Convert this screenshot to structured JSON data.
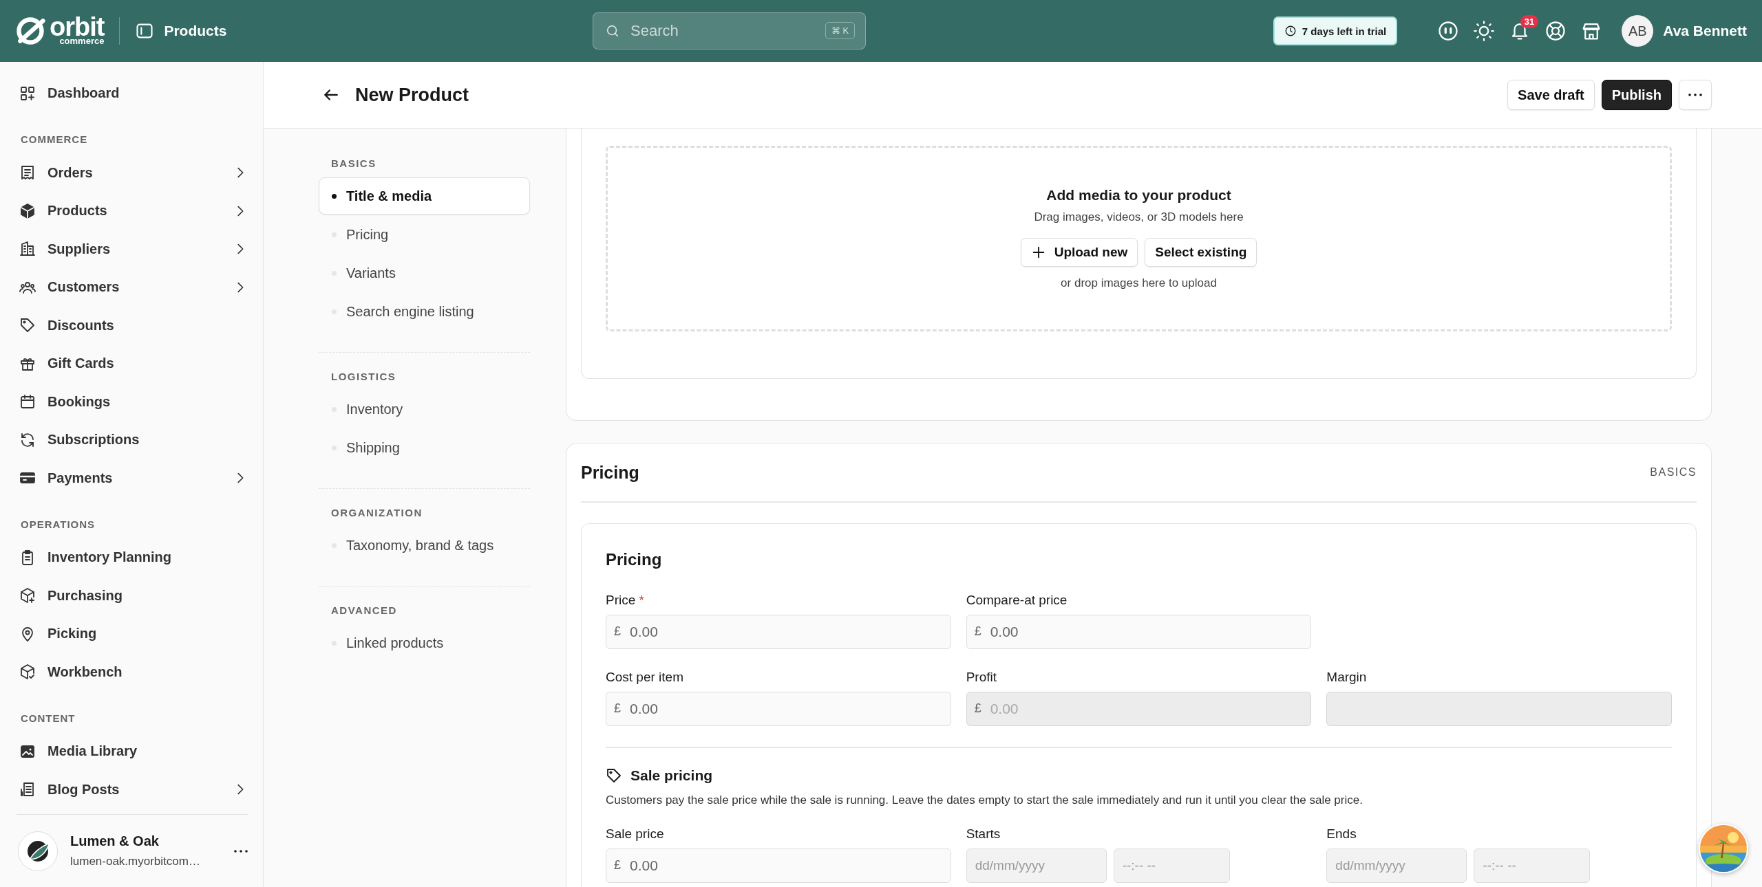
{
  "topbar": {
    "brand": {
      "name": "orbit",
      "tagline": "commerce"
    },
    "page": "Products",
    "search": {
      "placeholder": "Search",
      "shortcut": "⌘ K"
    },
    "trial": "7 days left in trial",
    "notifications": "31",
    "user": {
      "initials": "AB",
      "name": "Ava Bennett"
    }
  },
  "sidebar": {
    "items": [
      {
        "label": "Dashboard",
        "expandable": false
      }
    ],
    "sections": [
      {
        "heading": "COMMERCE",
        "items": [
          {
            "label": "Orders",
            "expandable": true
          },
          {
            "label": "Products",
            "expandable": true
          },
          {
            "label": "Suppliers",
            "expandable": true
          },
          {
            "label": "Customers",
            "expandable": true
          },
          {
            "label": "Discounts",
            "expandable": false
          },
          {
            "label": "Gift Cards",
            "expandable": false
          },
          {
            "label": "Bookings",
            "expandable": false
          },
          {
            "label": "Subscriptions",
            "expandable": false
          },
          {
            "label": "Payments",
            "expandable": true
          }
        ]
      },
      {
        "heading": "OPERATIONS",
        "items": [
          {
            "label": "Inventory Planning",
            "expandable": false
          },
          {
            "label": "Purchasing",
            "expandable": false
          },
          {
            "label": "Picking",
            "expandable": false
          },
          {
            "label": "Workbench",
            "expandable": false
          }
        ]
      },
      {
        "heading": "CONTENT",
        "items": [
          {
            "label": "Media Library",
            "expandable": false
          },
          {
            "label": "Blog Posts",
            "expandable": true
          }
        ]
      }
    ],
    "store": {
      "name": "Lumen & Oak",
      "domain": "lumen-oak.myorbitcom…"
    }
  },
  "header": {
    "title": "New Product",
    "actions": [
      {
        "kind": "secondary",
        "label": "Save draft"
      },
      {
        "kind": "primary",
        "label": "Publish"
      },
      {
        "kind": "more"
      }
    ]
  },
  "section_nav": [
    {
      "heading": "BASICS",
      "items": [
        {
          "label": "Title & media",
          "selected": true
        },
        {
          "label": "Pricing",
          "selected": false
        },
        {
          "label": "Variants",
          "selected": false
        },
        {
          "label": "Search engine listing",
          "selected": false
        }
      ]
    },
    {
      "heading": "LOGISTICS",
      "items": [
        {
          "label": "Inventory",
          "selected": false
        },
        {
          "label": "Shipping",
          "selected": false
        }
      ]
    },
    {
      "heading": "ORGANIZATION",
      "items": [
        {
          "label": "Taxonomy, brand & tags",
          "selected": false
        }
      ]
    },
    {
      "heading": "ADVANCED",
      "items": [
        {
          "label": "Linked products",
          "selected": false
        }
      ]
    }
  ],
  "media": {
    "title": "Add media to your product",
    "hint": "Drag images, videos, or 3D models here",
    "buttons": [
      {
        "kind": "upload",
        "label": "Upload new"
      },
      {
        "kind": "plain",
        "label": "Select existing"
      }
    ],
    "note": "or drop images here to upload"
  },
  "pricing_section": {
    "title": "Pricing",
    "tag": "BASICS",
    "card": {
      "title": "Pricing",
      "rows": [
        [
          {
            "label": "Price",
            "required_mark": "*",
            "inputs": [
              {
                "kind": "money",
                "prefix": "£",
                "placeholder": "0.00",
                "disabled": false
              }
            ]
          },
          {
            "label": "Compare-at price",
            "inputs": [
              {
                "kind": "money",
                "prefix": "£",
                "placeholder": "0.00",
                "disabled": false
              }
            ]
          }
        ],
        [
          {
            "label": "Cost per item",
            "inputs": [
              {
                "kind": "money",
                "prefix": "£",
                "placeholder": "0.00",
                "disabled": false
              }
            ]
          },
          {
            "label": "Profit",
            "inputs": [
              {
                "kind": "money",
                "prefix": "£",
                "placeholder": "0.00",
                "disabled": true
              }
            ]
          },
          {
            "label": "Margin",
            "inputs": [
              {
                "kind": "money",
                "disabled": true
              }
            ]
          }
        ]
      ]
    },
    "sale": {
      "title": "Sale pricing",
      "description": "Customers pay the sale price while the sale is running. Leave the dates empty to start the sale immediately and run it until you clear the sale price.",
      "fields": [
        {
          "label": "Sale price",
          "inputs": [
            {
              "kind": "money",
              "prefix": "£",
              "placeholder": "0.00",
              "disabled": false
            }
          ]
        },
        {
          "label": "Starts",
          "inputs": [
            {
              "kind": "date",
              "placeholder": "dd/mm/yyyy"
            },
            {
              "kind": "time",
              "placeholder": "--:-- --"
            }
          ]
        },
        {
          "label": "Ends",
          "inputs": [
            {
              "kind": "date",
              "placeholder": "dd/mm/yyyy"
            },
            {
              "kind": "time",
              "placeholder": "--:-- --"
            }
          ]
        }
      ]
    }
  }
}
